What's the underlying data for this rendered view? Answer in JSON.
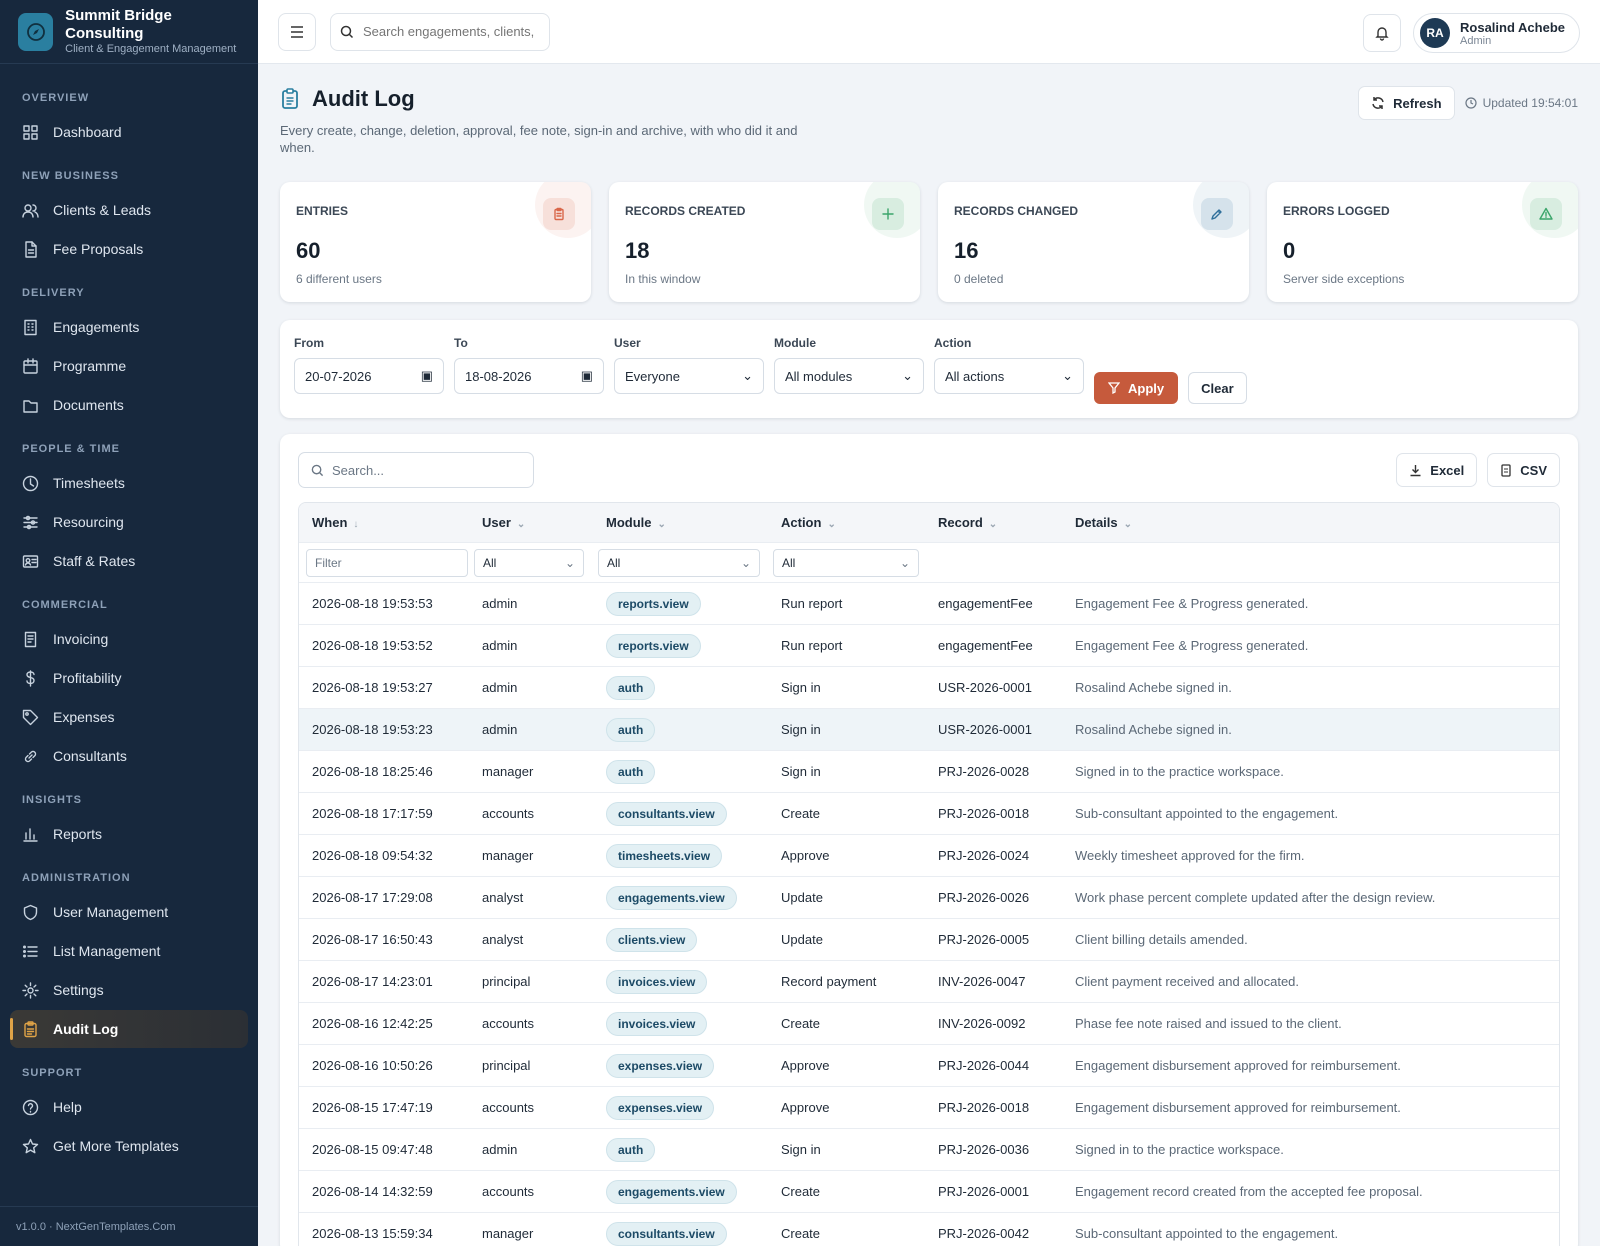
{
  "brand": {
    "name": "Summit Bridge Consulting",
    "tagline": "Client & Engagement Management"
  },
  "nav": [
    {
      "section": "OVERVIEW",
      "items": [
        {
          "label": "Dashboard",
          "icon": "grid-icon"
        }
      ]
    },
    {
      "section": "NEW BUSINESS",
      "items": [
        {
          "label": "Clients & Leads",
          "icon": "users-icon"
        },
        {
          "label": "Fee Proposals",
          "icon": "file-icon"
        }
      ]
    },
    {
      "section": "DELIVERY",
      "items": [
        {
          "label": "Engagements",
          "icon": "building-icon"
        },
        {
          "label": "Programme",
          "icon": "calendar-icon"
        },
        {
          "label": "Documents",
          "icon": "folder-icon"
        }
      ]
    },
    {
      "section": "PEOPLE & TIME",
      "items": [
        {
          "label": "Timesheets",
          "icon": "clock-icon"
        },
        {
          "label": "Resourcing",
          "icon": "sliders-icon"
        },
        {
          "label": "Staff & Rates",
          "icon": "id-card-icon"
        }
      ]
    },
    {
      "section": "COMMERCIAL",
      "items": [
        {
          "label": "Invoicing",
          "icon": "receipt-icon"
        },
        {
          "label": "Profitability",
          "icon": "dollar-icon"
        },
        {
          "label": "Expenses",
          "icon": "tag-icon"
        },
        {
          "label": "Consultants",
          "icon": "link-icon"
        }
      ]
    },
    {
      "section": "INSIGHTS",
      "items": [
        {
          "label": "Reports",
          "icon": "bar-chart-icon"
        }
      ]
    },
    {
      "section": "ADMINISTRATION",
      "items": [
        {
          "label": "User Management",
          "icon": "shield-icon"
        },
        {
          "label": "List Management",
          "icon": "list-icon"
        },
        {
          "label": "Settings",
          "icon": "gear-icon"
        },
        {
          "label": "Audit Log",
          "icon": "clipboard-icon",
          "active": true
        }
      ]
    },
    {
      "section": "SUPPORT",
      "items": [
        {
          "label": "Help",
          "icon": "help-icon"
        },
        {
          "label": "Get More Templates",
          "icon": "star-icon"
        }
      ]
    }
  ],
  "version": "v1.0.0 · NextGenTemplates.Com",
  "topbar": {
    "search_placeholder": "Search engagements, clients, s",
    "user_name": "Rosalind Achebe",
    "user_role": "Admin",
    "user_initials": "RA"
  },
  "page": {
    "title": "Audit Log",
    "subtitle": "Every create, change, deletion, approval, fee note, sign-in and archive, with who did it and when.",
    "refresh_label": "Refresh",
    "updated": "Updated 19:54:01"
  },
  "stats": [
    {
      "label": "ENTRIES",
      "value": "60",
      "note": "6 different users",
      "icon": "clipboard-icon",
      "color": "#d9674a"
    },
    {
      "label": "RECORDS CREATED",
      "value": "18",
      "note": "In this window",
      "icon": "plus-icon",
      "color": "#3ba56a"
    },
    {
      "label": "RECORDS CHANGED",
      "value": "16",
      "note": "0 deleted",
      "icon": "pencil-icon",
      "color": "#2f6f9a"
    },
    {
      "label": "ERRORS LOGGED",
      "value": "0",
      "note": "Server side exceptions",
      "icon": "warning-icon",
      "color": "#3ba56a"
    }
  ],
  "filters": {
    "from_label": "From",
    "from_value": "20-07-2026",
    "to_label": "To",
    "to_value": "18-08-2026",
    "user_label": "User",
    "user_value": "Everyone",
    "module_label": "Module",
    "module_value": "All modules",
    "action_label": "Action",
    "action_value": "All actions",
    "apply_label": "Apply",
    "clear_label": "Clear"
  },
  "table": {
    "search_placeholder": "Search...",
    "excel_label": "Excel",
    "csv_label": "CSV",
    "columns": [
      "When",
      "User",
      "Module",
      "Action",
      "Record",
      "Details"
    ],
    "filter_placeholder": "Filter",
    "filter_all": "All",
    "rows": [
      [
        "2026-08-18 19:53:53",
        "admin",
        "reports.view",
        "Run report",
        "engagementFee",
        "Engagement Fee & Progress generated."
      ],
      [
        "2026-08-18 19:53:52",
        "admin",
        "reports.view",
        "Run report",
        "engagementFee",
        "Engagement Fee & Progress generated."
      ],
      [
        "2026-08-18 19:53:27",
        "admin",
        "auth",
        "Sign in",
        "USR-2026-0001",
        "Rosalind Achebe signed in."
      ],
      [
        "2026-08-18 19:53:23",
        "admin",
        "auth",
        "Sign in",
        "USR-2026-0001",
        "Rosalind Achebe signed in."
      ],
      [
        "2026-08-18 18:25:46",
        "manager",
        "auth",
        "Sign in",
        "PRJ-2026-0028",
        "Signed in to the practice workspace."
      ],
      [
        "2026-08-18 17:17:59",
        "accounts",
        "consultants.view",
        "Create",
        "PRJ-2026-0018",
        "Sub-consultant appointed to the engagement."
      ],
      [
        "2026-08-18 09:54:32",
        "manager",
        "timesheets.view",
        "Approve",
        "PRJ-2026-0024",
        "Weekly timesheet approved for the firm."
      ],
      [
        "2026-08-17 17:29:08",
        "analyst",
        "engagements.view",
        "Update",
        "PRJ-2026-0026",
        "Work phase percent complete updated after the design review."
      ],
      [
        "2026-08-17 16:50:43",
        "analyst",
        "clients.view",
        "Update",
        "PRJ-2026-0005",
        "Client billing details amended."
      ],
      [
        "2026-08-17 14:23:01",
        "principal",
        "invoices.view",
        "Record payment",
        "INV-2026-0047",
        "Client payment received and allocated."
      ],
      [
        "2026-08-16 12:42:25",
        "accounts",
        "invoices.view",
        "Create",
        "INV-2026-0092",
        "Phase fee note raised and issued to the client."
      ],
      [
        "2026-08-16 10:50:26",
        "principal",
        "expenses.view",
        "Approve",
        "PRJ-2026-0044",
        "Engagement disbursement approved for reimbursement."
      ],
      [
        "2026-08-15 17:47:19",
        "accounts",
        "expenses.view",
        "Approve",
        "PRJ-2026-0018",
        "Engagement disbursement approved for reimbursement."
      ],
      [
        "2026-08-15 09:47:48",
        "admin",
        "auth",
        "Sign in",
        "PRJ-2026-0036",
        "Signed in to the practice workspace."
      ],
      [
        "2026-08-14 14:32:59",
        "accounts",
        "engagements.view",
        "Create",
        "PRJ-2026-0001",
        "Engagement record created from the accepted fee proposal."
      ],
      [
        "2026-08-13 15:59:34",
        "manager",
        "consultants.view",
        "Create",
        "PRJ-2026-0042",
        "Sub-consultant appointed to the engagement."
      ]
    ],
    "highlighted_row": 3
  }
}
